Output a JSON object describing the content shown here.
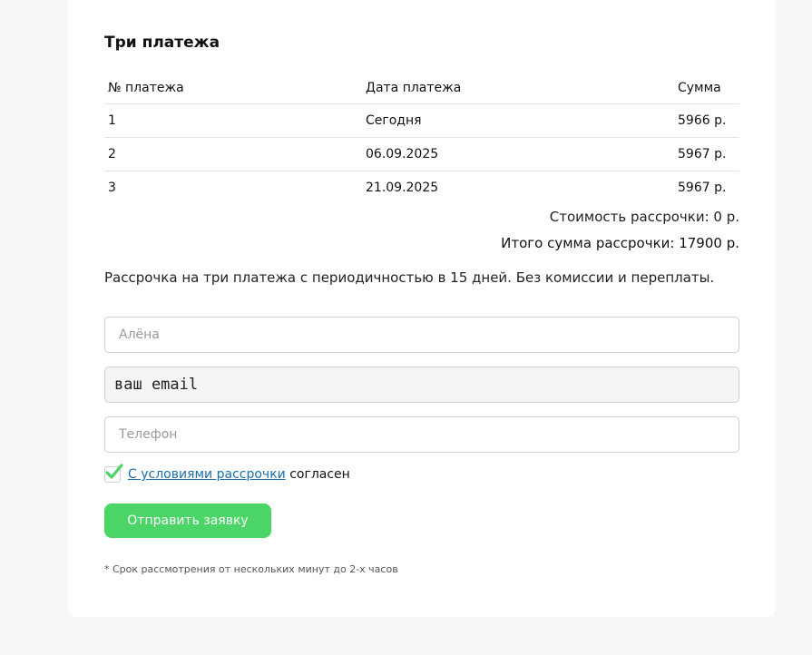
{
  "section": {
    "title": "Три платежа"
  },
  "table": {
    "headers": [
      "№ платежа",
      "Дата платежа",
      "Сумма"
    ],
    "rows": [
      [
        "1",
        "Сегодня",
        "5966 р."
      ],
      [
        "2",
        "06.09.2025",
        "5967 р."
      ],
      [
        "3",
        "21.09.2025",
        "5967 р."
      ]
    ]
  },
  "totals": {
    "cost": "Стоимость рассрочки: 0 р.",
    "total": "Итого сумма рассрочки: 17900 р."
  },
  "description": "Рассрочка на три платежа с периодичностью в 15 дней. Без комиссии и переплаты.",
  "form": {
    "name_placeholder": "Алёна",
    "email_placeholder": "ваш email",
    "phone_placeholder": "Телефон",
    "agree_link": "С условиями рассрочки",
    "agree_suffix": " согласен",
    "agree_checked": true,
    "submit_label": "Отправить заявку",
    "note": "* Срок рассмотрения от нескольких минут до 2-х часов"
  },
  "colors": {
    "accent": "#4cd567",
    "link": "#1b6fa8",
    "check": "#4cd567"
  },
  "icons": {
    "checkbox": "checkmark-icon"
  }
}
